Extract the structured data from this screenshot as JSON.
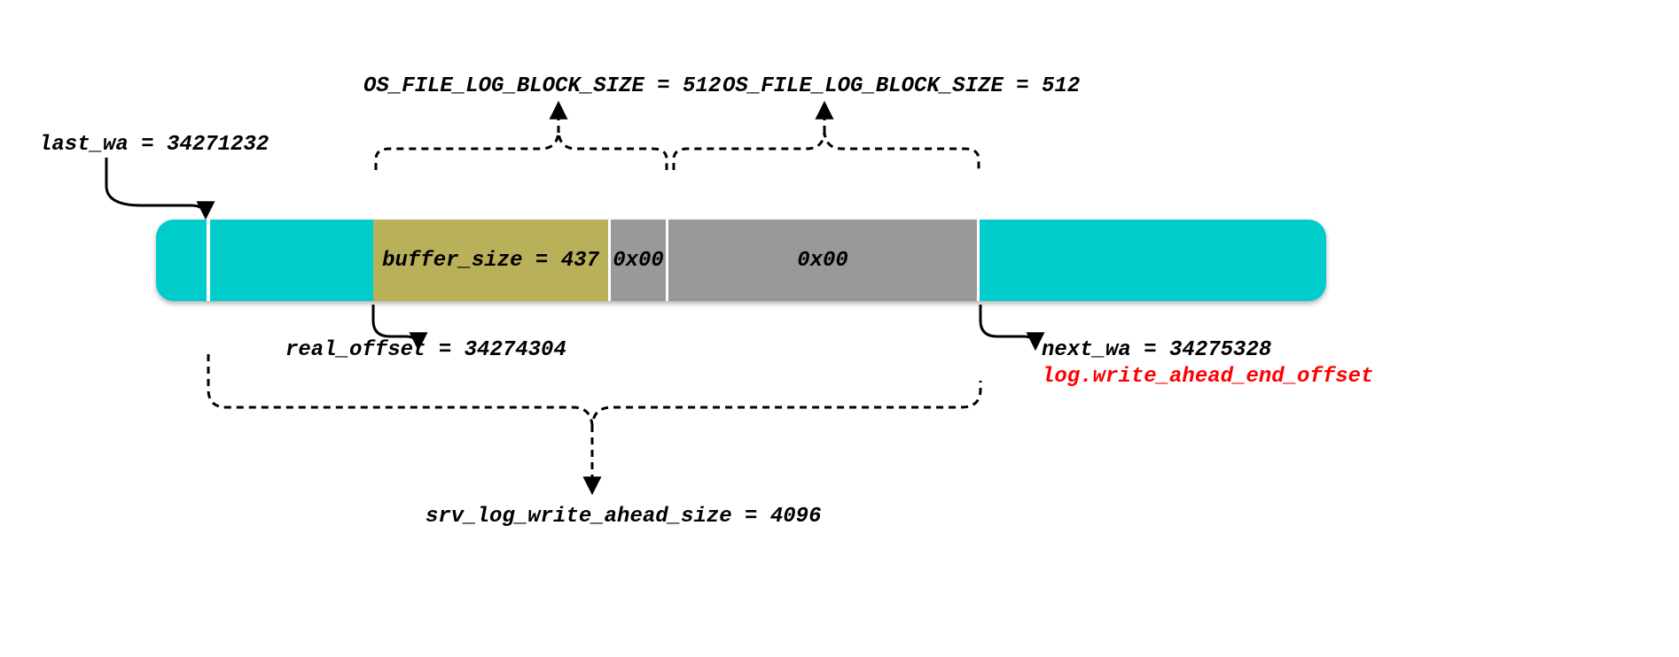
{
  "labels": {
    "last_wa": "last_wa = 34271232",
    "block1": "OS_FILE_LOG_BLOCK_SIZE = 512",
    "block2": "OS_FILE_LOG_BLOCK_SIZE = 512",
    "buffer_size": "buffer_size = 437",
    "zero1": "0x00",
    "zero2": "0x00",
    "real_offset": "real_offset = 34274304",
    "next_wa": "next_wa = 34275328",
    "write_ahead_end": "log.write_ahead_end_offset",
    "srv_size": "srv_log_write_ahead_size = 4096"
  },
  "colors": {
    "bar": "#00cccc",
    "buffer": "#b9b05a",
    "zero": "#999999",
    "red": "#ff0000"
  }
}
